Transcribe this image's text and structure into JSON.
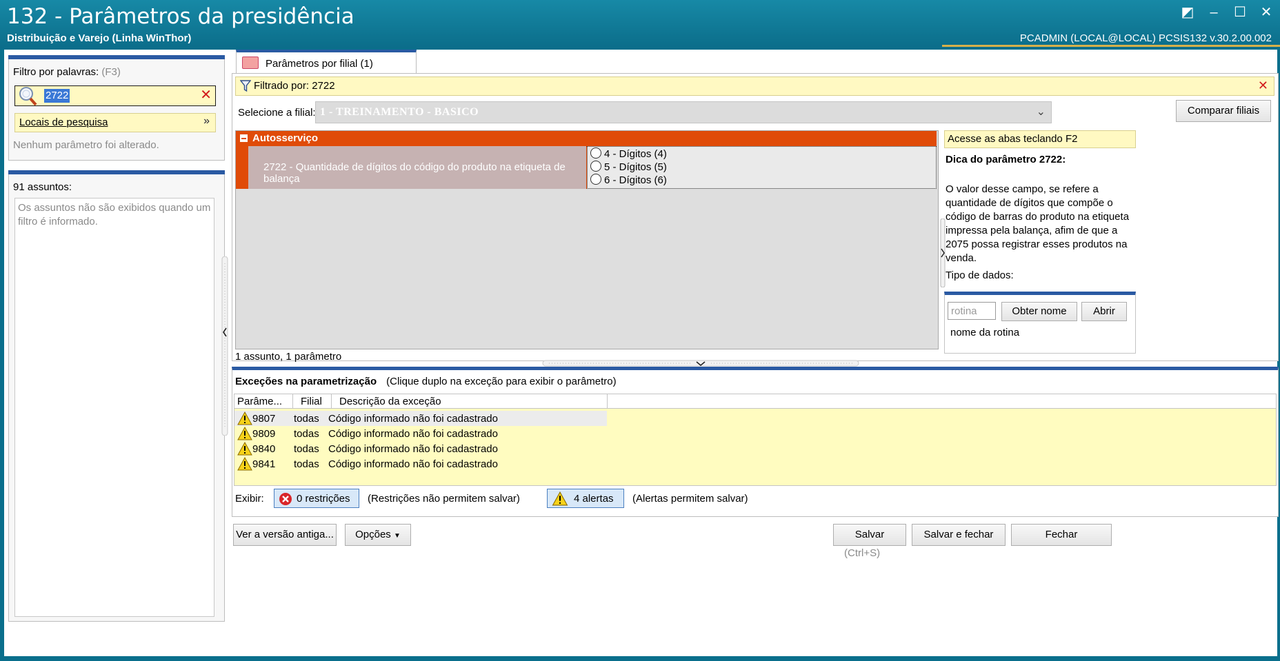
{
  "window": {
    "title": "132 - Parâmetros da presidência",
    "subtitle": "Distribuição e Varejo (Linha WinThor)",
    "user_info": "PCADMIN (LOCAL@LOCAL)   PCSIS132  v.30.2.00.002",
    "controls": [
      "◩",
      "–",
      "☐",
      "✕"
    ]
  },
  "left": {
    "filter_label": "Filtro por palavras:",
    "filter_shortcut": "(F3)",
    "search_value": "2722",
    "search_locations": "Locais de pesquisa",
    "no_changes": "Nenhum parâmetro foi alterado.",
    "subjects_label": "91 assuntos:",
    "subjects_message": "Os assuntos não são exibidos quando um filtro é informado."
  },
  "tab": {
    "label": "Parâmetros por filial  (1)"
  },
  "filter_bar": {
    "text": "Filtrado por: 2722"
  },
  "filial": {
    "label": "Selecione a filial:",
    "value": "1 - TREINAMENTO - BASICO",
    "compare_button": "Comparar filiais"
  },
  "group": {
    "title": "Autosserviço",
    "param_description": "2722 - Quantidade de dígitos do código do produto na etiqueta de balança",
    "options": [
      "4 - Dígitos (4)",
      "5 - Dígitos (5)",
      "6 - Dígitos (6)"
    ]
  },
  "count": "1 assunto, 1 parâmetro",
  "side": {
    "hint": "Acesse as abas teclando F2",
    "dica_title": "Dica do parâmetro 2722:",
    "dica_text": "O valor desse campo, se refere a quantidade de dígitos que compõe o código de barras do produto na etiqueta impressa pela balança, afim de que a 2075 possa registrar esses produtos na venda.",
    "tipo": "Tipo de dados:",
    "rotina_placeholder": "rotina",
    "obter_nome": "Obter nome",
    "abrir": "Abrir",
    "rotina_name": "nome da rotina"
  },
  "exceptions": {
    "title": "Exceções na parametrização",
    "subtitle": "(Clique duplo na exceção para exibir o parâmetro)",
    "columns": [
      "Parâme...",
      "Filial",
      "Descrição da exceção"
    ],
    "rows": [
      {
        "param": "9807",
        "filial": "todas",
        "desc": "Código informado não foi cadastrado"
      },
      {
        "param": "9809",
        "filial": "todas",
        "desc": "Código informado não foi cadastrado"
      },
      {
        "param": "9840",
        "filial": "todas",
        "desc": "Código informado não foi cadastrado"
      },
      {
        "param": "9841",
        "filial": "todas",
        "desc": "Código informado não foi cadastrado"
      }
    ],
    "exibir": "Exibir:",
    "restricoes_btn": "0 restrições",
    "restricoes_note": "(Restrições não permitem salvar)",
    "alertas_btn": "4 alertas",
    "alertas_note": "(Alertas permitem salvar)"
  },
  "bottom": {
    "old_version": "Ver a versão antiga...",
    "options": "Opções",
    "save": "Salvar",
    "save_close": "Salvar e fechar",
    "close": "Fechar",
    "save_shortcut": "(Ctrl+S)"
  },
  "colors": {
    "titlebar": "#0b6d8a",
    "accent_blue": "#2a5aa3",
    "group_orange": "#e04b08",
    "yellow_bg": "#fff9c2"
  }
}
